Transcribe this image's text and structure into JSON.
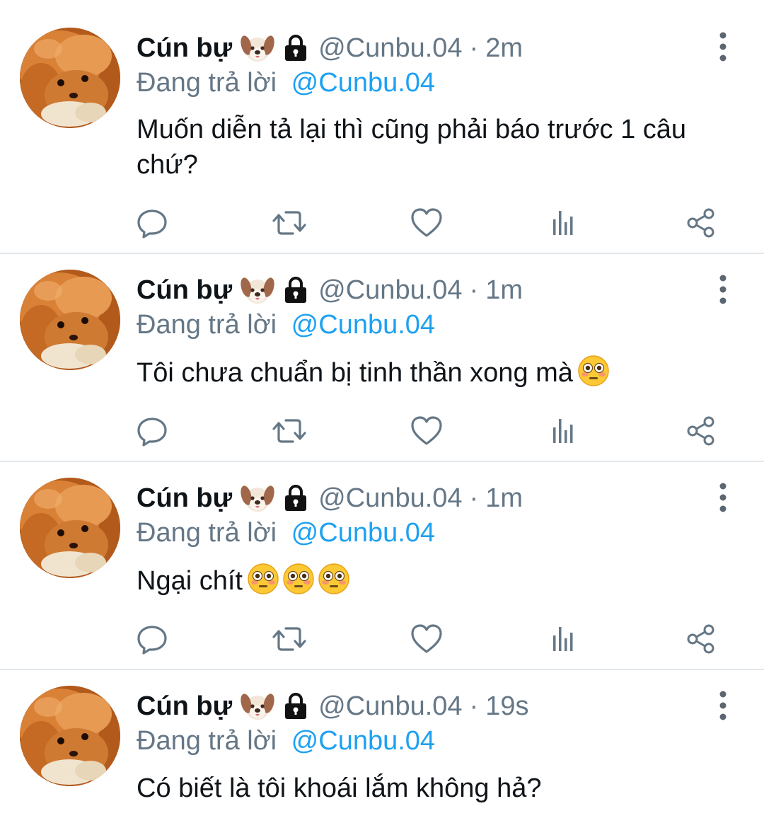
{
  "colors": {
    "text": "#0f1419",
    "muted": "#657786",
    "link": "#1da1f2",
    "divider": "#e1e8ed"
  },
  "tweets": [
    {
      "name": "Cún bự",
      "handle": "@Cunbu.04",
      "separator": "·",
      "time": "2m",
      "reply_prefix": "Đang trả lời",
      "reply_to": "@Cunbu.04",
      "text": "Muốn diễn tả lại thì cũng phải báo trước 1 câu chứ?",
      "emoji_count": 0,
      "icons": [
        "dog-face-icon",
        "lock-icon",
        "more-vertical-icon"
      ]
    },
    {
      "name": "Cún bự",
      "handle": "@Cunbu.04",
      "separator": "·",
      "time": "1m",
      "reply_prefix": "Đang trả lời",
      "reply_to": "@Cunbu.04",
      "text": "Tôi chưa chuẩn bị tinh thần xong mà",
      "emoji_count": 1,
      "emoji": "flushed-face-icon"
    },
    {
      "name": "Cún bự",
      "handle": "@Cunbu.04",
      "separator": "·",
      "time": "1m",
      "reply_prefix": "Đang trả lời",
      "reply_to": "@Cunbu.04",
      "text": "Ngại chít",
      "emoji_count": 3,
      "emoji": "flushed-face-icon"
    },
    {
      "name": "Cún bự",
      "handle": "@Cunbu.04",
      "separator": "·",
      "time": "19s",
      "reply_prefix": "Đang trả lời",
      "reply_to": "@Cunbu.04",
      "text": "Có biết là tôi khoái lắm không hả?",
      "emoji_count": 0
    }
  ],
  "action_icons": [
    "reply-icon",
    "retweet-icon",
    "like-icon",
    "analytics-icon",
    "share-icon"
  ]
}
